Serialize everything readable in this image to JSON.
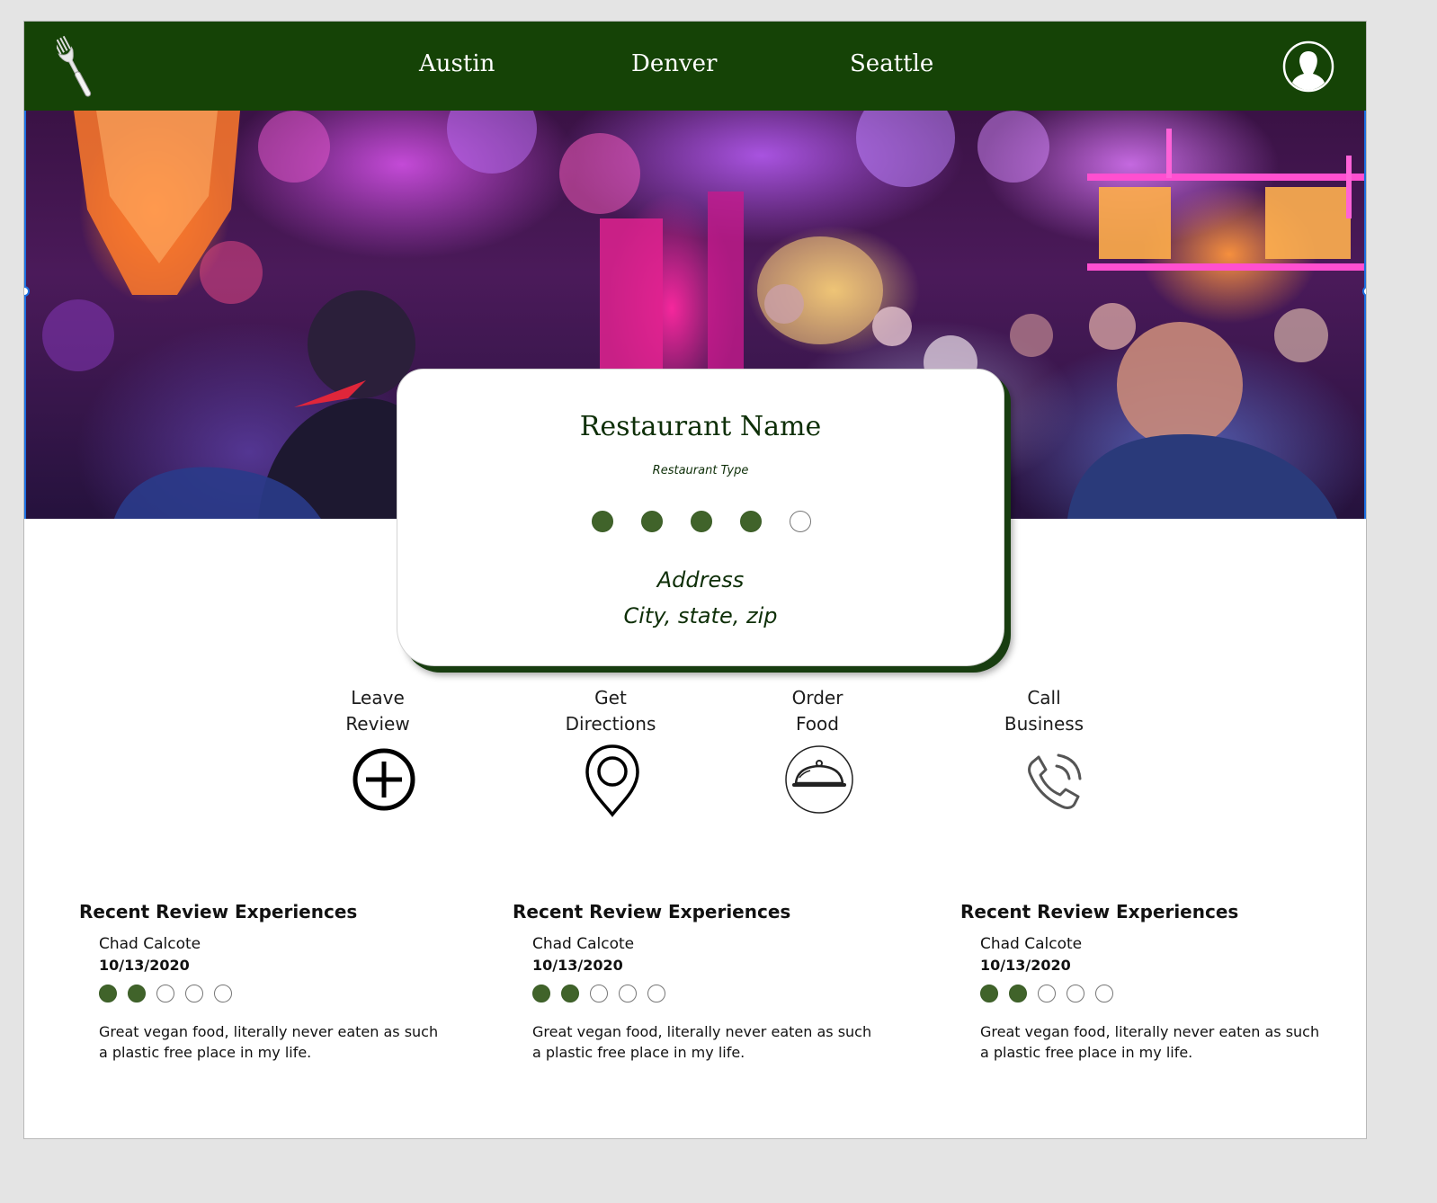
{
  "nav": {
    "logo_icon": "fork-icon",
    "links": [
      "Austin",
      "Denver",
      "Seattle"
    ],
    "profile_icon": "user-avatar-icon",
    "bar_color": "#154306"
  },
  "restaurant": {
    "name": "Restaurant Name",
    "type": "Restaurant Type",
    "rating": 4,
    "rating_max": 5,
    "address_line1": "Address",
    "address_line2": "City, state, zip"
  },
  "actions": [
    {
      "line1": "Leave",
      "line2": "Review",
      "icon": "plus-circle-icon"
    },
    {
      "line1": "Get",
      "line2": "Directions",
      "icon": "map-pin-icon"
    },
    {
      "line1": "Order",
      "line2": "Food",
      "icon": "food-cloche-icon"
    },
    {
      "line1": "Call",
      "line2": "Business",
      "icon": "phone-icon"
    }
  ],
  "reviews": [
    {
      "heading": "Recent Review Experiences",
      "author": "Chad Calcote",
      "date": "10/13/2020",
      "rating": 2,
      "rating_max": 5,
      "text": "Great vegan food, literally never eaten as such a plastic free place in my life."
    },
    {
      "heading": "Recent Review Experiences",
      "author": "Chad Calcote",
      "date": "10/13/2020",
      "rating": 2,
      "rating_max": 5,
      "text": "Great vegan food, literally never eaten as such a plastic free place in my life."
    },
    {
      "heading": "Recent Review Experiences",
      "author": "Chad Calcote",
      "date": "10/13/2020",
      "rating": 2,
      "rating_max": 5,
      "text": "Great vegan food, literally never eaten as such a plastic free place in my life."
    }
  ],
  "colors": {
    "accent": "#40632a",
    "text_dark": "#0e2f08",
    "hero_highlight": "#ff2ea6"
  }
}
